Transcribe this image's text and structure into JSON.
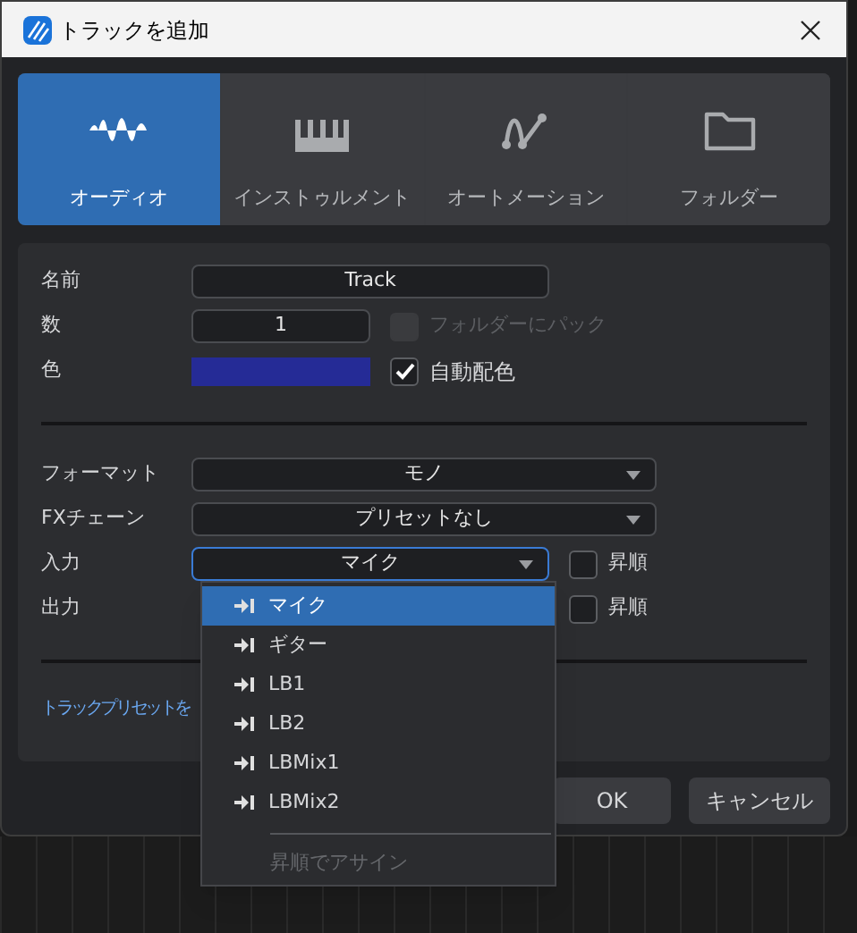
{
  "window": {
    "title": "トラックを追加"
  },
  "tabs": [
    {
      "label": "オーディオ",
      "kind": "audio",
      "selected": true
    },
    {
      "label": "インストゥルメント",
      "kind": "instrument",
      "selected": false
    },
    {
      "label": "オートメーション",
      "kind": "automation",
      "selected": false
    },
    {
      "label": "フォルダー",
      "kind": "folder",
      "selected": false
    }
  ],
  "form": {
    "name": {
      "label": "名前",
      "value": "Track"
    },
    "count": {
      "label": "数",
      "value": "1"
    },
    "pack_folder": {
      "label": "フォルダーにパック",
      "checked": false,
      "disabled": true
    },
    "color": {
      "label": "色",
      "color": "#252b96"
    },
    "auto_color": {
      "label": "自動配色",
      "checked": true
    },
    "format": {
      "label": "フォーマット",
      "value": "モノ"
    },
    "fx_chain": {
      "label": "FXチェーン",
      "value": "プリセットなし"
    },
    "input": {
      "label": "入力",
      "value": "マイク",
      "expanded": true
    },
    "input_ascending": {
      "label": "昇順",
      "checked": false
    },
    "output": {
      "label": "出力"
    },
    "output_ascending": {
      "label": "昇順",
      "checked": false
    },
    "preset_link": "トラックプリセットを"
  },
  "input_menu": {
    "items": [
      {
        "label": "マイク",
        "selected": true
      },
      {
        "label": "ギター",
        "selected": false
      },
      {
        "label": "LB1",
        "selected": false
      },
      {
        "label": "LB2",
        "selected": false
      },
      {
        "label": "LBMix1",
        "selected": false
      },
      {
        "label": "LBMix2",
        "selected": false
      }
    ],
    "footer": {
      "label": "昇順でアサイン",
      "disabled": true
    }
  },
  "buttons": [
    "OK",
    "キャンセル"
  ]
}
